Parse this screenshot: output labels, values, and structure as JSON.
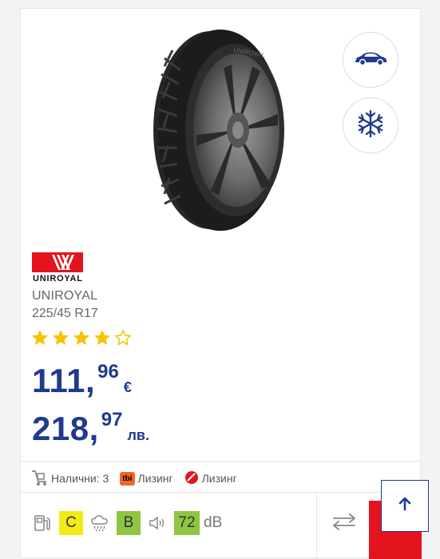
{
  "product": {
    "brand": "UNIROYAL",
    "logo_text": "UNIROYAL",
    "size": "225/45 R17",
    "rating": 4,
    "rating_max": 5
  },
  "price": {
    "eur_int": "111,",
    "eur_dec": "96",
    "eur_currency": "€",
    "bgn_int": "218,",
    "bgn_dec": "97",
    "bgn_currency": "лв."
  },
  "availability": {
    "stock_label": "Налични: 3",
    "tbi_badge": "tbi",
    "tbi_label": "Лизинг",
    "unicredit_label": "Лизинг"
  },
  "eu_label": {
    "fuel_class": "C",
    "fuel_color": "#f4ea16",
    "wet_class": "B",
    "wet_color": "#8dc641",
    "noise_value": "72",
    "noise_unit": "dB"
  },
  "icons": {
    "car": "car-icon",
    "season": "snowflake-icon",
    "compare": "compare-arrows-icon",
    "scroll_top": "arrow-up-icon"
  },
  "colors": {
    "brand_blue": "#1f3a8f",
    "cart_red": "#e3141e",
    "star": "#f5c400"
  }
}
